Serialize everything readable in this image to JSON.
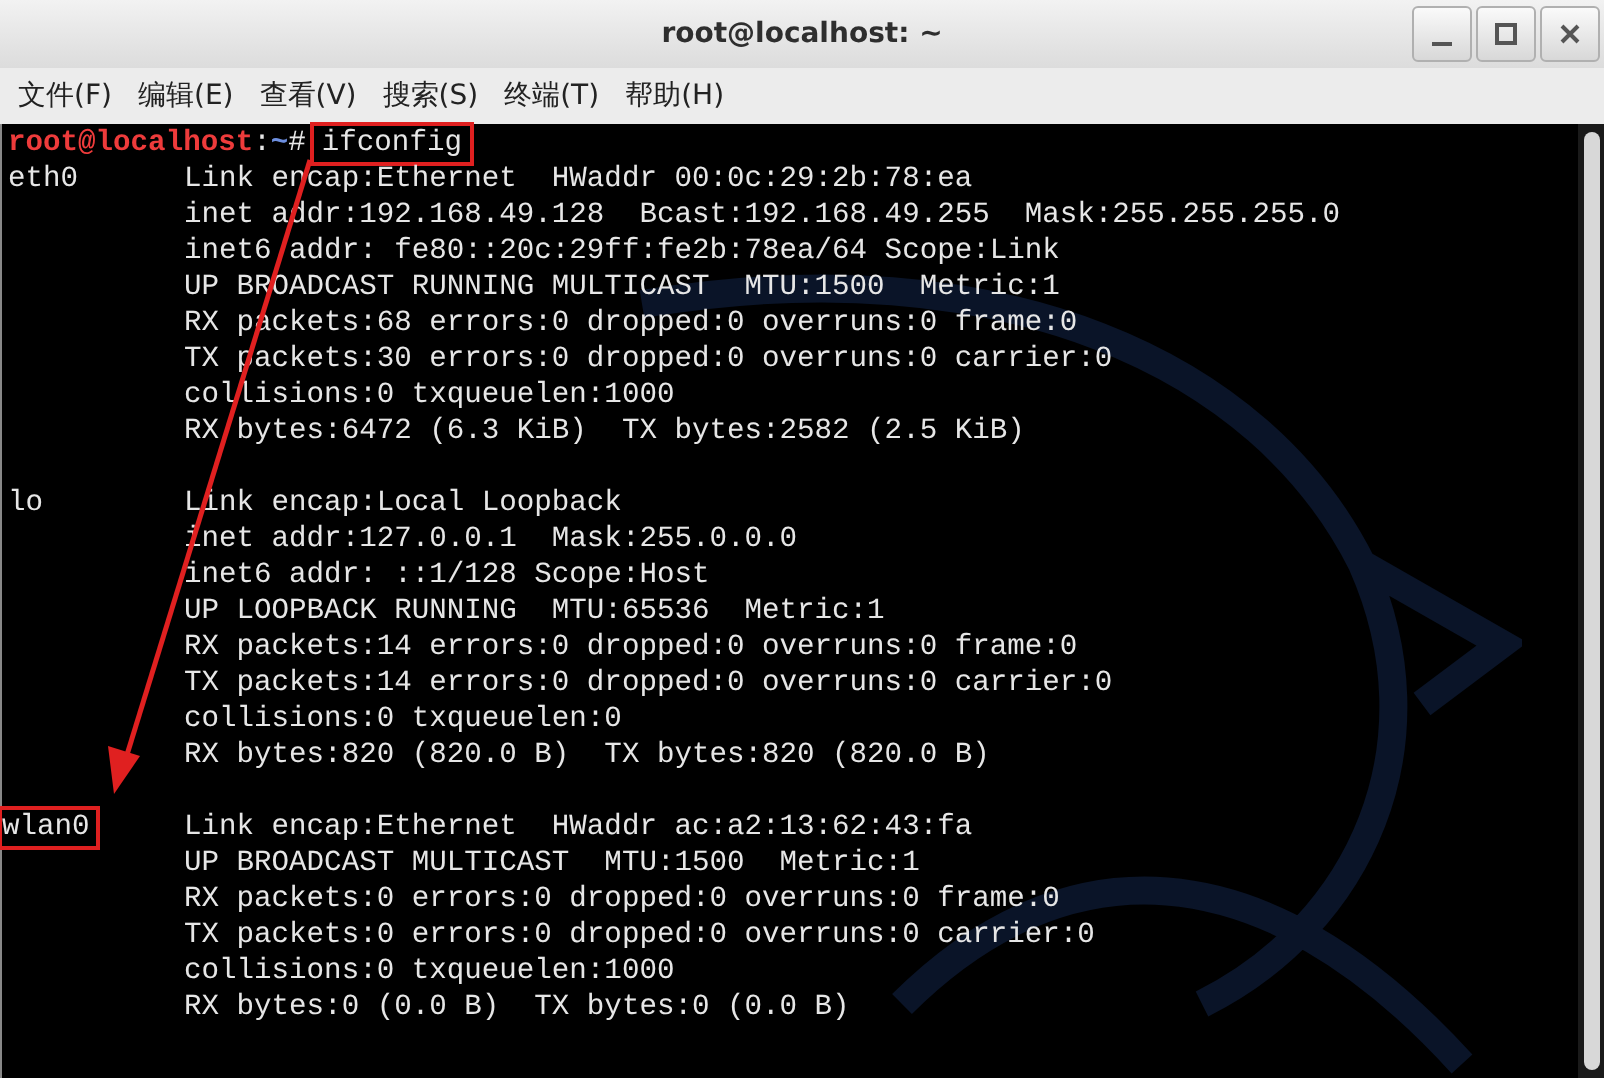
{
  "window": {
    "title": "root@localhost: ~"
  },
  "menu": [
    "文件(F)",
    "编辑(E)",
    "查看(V)",
    "搜索(S)",
    "终端(T)",
    "帮助(H)"
  ],
  "prompt": {
    "user_host": "root@localhost",
    "separator": ":",
    "cwd": "~",
    "symbol": "#",
    "command": "ifconfig",
    "command_highlighted": true
  },
  "interfaces": [
    {
      "name": "eth0",
      "highlighted": false,
      "lines": [
        "Link encap:Ethernet  HWaddr 00:0c:29:2b:78:ea",
        "inet addr:192.168.49.128  Bcast:192.168.49.255  Mask:255.255.255.0",
        "inet6 addr: fe80::20c:29ff:fe2b:78ea/64 Scope:Link",
        "UP BROADCAST RUNNING MULTICAST  MTU:1500  Metric:1",
        "RX packets:68 errors:0 dropped:0 overruns:0 frame:0",
        "TX packets:30 errors:0 dropped:0 overruns:0 carrier:0",
        "collisions:0 txqueuelen:1000",
        "RX bytes:6472 (6.3 KiB)  TX bytes:2582 (2.5 KiB)"
      ]
    },
    {
      "name": "lo",
      "highlighted": false,
      "lines": [
        "Link encap:Local Loopback",
        "inet addr:127.0.0.1  Mask:255.0.0.0",
        "inet6 addr: ::1/128 Scope:Host",
        "UP LOOPBACK RUNNING  MTU:65536  Metric:1",
        "RX packets:14 errors:0 dropped:0 overruns:0 frame:0",
        "TX packets:14 errors:0 dropped:0 overruns:0 carrier:0",
        "collisions:0 txqueuelen:0",
        "RX bytes:820 (820.0 B)  TX bytes:820 (820.0 B)"
      ]
    },
    {
      "name": "wlan0",
      "highlighted": true,
      "lines": [
        "Link encap:Ethernet  HWaddr ac:a2:13:62:43:fa",
        "UP BROADCAST MULTICAST  MTU:1500  Metric:1",
        "RX packets:0 errors:0 dropped:0 overruns:0 frame:0",
        "TX packets:0 errors:0 dropped:0 overruns:0 carrier:0",
        "collisions:0 txqueuelen:1000",
        "RX bytes:0 (0.0 B)  TX bytes:0 (0.0 B)"
      ]
    }
  ]
}
